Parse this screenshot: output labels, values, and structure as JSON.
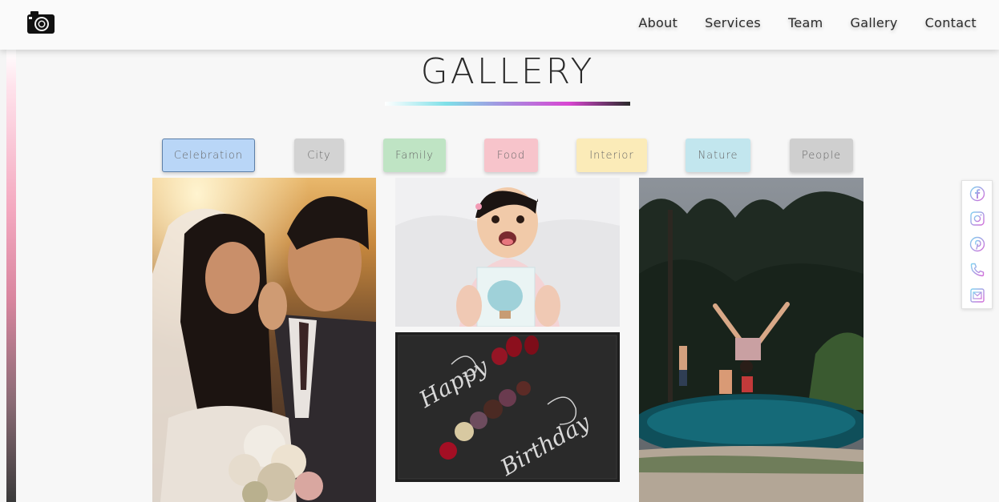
{
  "header": {
    "logo_icon": "camera-icon",
    "nav": [
      {
        "label": "About"
      },
      {
        "label": "Services"
      },
      {
        "label": "Team"
      },
      {
        "label": "Gallery"
      },
      {
        "label": "Contact"
      }
    ]
  },
  "gallery": {
    "title": "GALLERY",
    "filters": [
      {
        "label": "Celebration",
        "color": "#b9d6f7",
        "active": true
      },
      {
        "label": "City",
        "color": "#d3d3d3"
      },
      {
        "label": "Family",
        "color": "#bfe4c4"
      },
      {
        "label": "Food",
        "color": "#f7c4cb"
      },
      {
        "label": "Interior",
        "color": "#fbebb8"
      },
      {
        "label": "Nature",
        "color": "#c2e6ee"
      },
      {
        "label": "People",
        "color": "#cfcfcf"
      }
    ],
    "photos": [
      {
        "subject": "wedding couple"
      },
      {
        "subject": "smiling baby"
      },
      {
        "subject": "happy birthday dessert plate",
        "text_on_plate": "Happy Birthday"
      },
      {
        "subject": "pool party backflip"
      }
    ]
  },
  "social": {
    "icons": [
      "facebook-icon",
      "instagram-icon",
      "pinterest-icon",
      "phone-icon",
      "email-icon"
    ],
    "accent_gradient": [
      "#7fd3f0",
      "#d36ad8"
    ]
  }
}
